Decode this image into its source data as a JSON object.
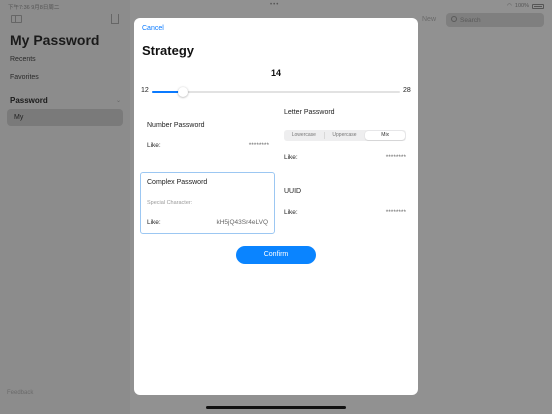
{
  "status_bar": {
    "time": "下午7:36 9月8日周二",
    "battery": "100%"
  },
  "sidebar": {
    "title": "My Password",
    "items": [
      {
        "label": "Recents"
      },
      {
        "label": "Favorites"
      }
    ],
    "section": "Password",
    "selected_item": "My",
    "footer": "Feedback"
  },
  "toolbar": {
    "new_label": "New",
    "search_placeholder": "Search"
  },
  "sheet": {
    "cancel": "Cancel",
    "title": "Strategy",
    "length": {
      "value": "14",
      "min": "12",
      "max": "28",
      "fraction": 0.125
    },
    "cards": {
      "number": {
        "title": "Number Password",
        "like_label": "Like:",
        "like_value": "********"
      },
      "letter": {
        "title": "Letter Password",
        "segments": [
          "Lowercase",
          "Uppercase",
          "Mix"
        ],
        "selected_segment": "Mix",
        "like_label": "Like:",
        "like_value": "********"
      },
      "complex": {
        "title": "Complex Password",
        "hint": "Special Character:",
        "like_label": "Like:",
        "like_value": "kH5jQ43Sr4eLVQ"
      },
      "uuid": {
        "title": "UUID",
        "like_label": "Like:",
        "like_value": "********"
      }
    },
    "confirm": "Confirm"
  },
  "colors": {
    "accent": "#0a84ff",
    "selected_border": "#9cc7f2"
  }
}
